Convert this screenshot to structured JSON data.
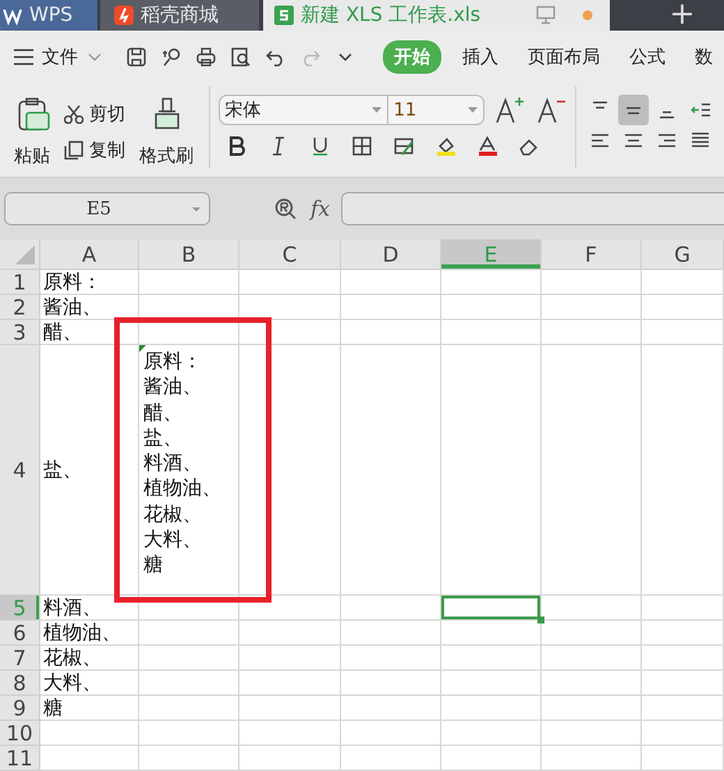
{
  "title_tabs": [
    {
      "kind": "wps",
      "label": "WPS",
      "selected": false
    },
    {
      "kind": "store",
      "label": "稻壳商城",
      "selected": false
    },
    {
      "kind": "sheet",
      "label": "新建 XLS 工作表.xls",
      "selected": true
    }
  ],
  "new_tab": "+",
  "menu": {
    "file_label": "文件",
    "tabs": [
      {
        "label": "开始",
        "selected": true
      },
      {
        "label": "插入",
        "selected": false
      },
      {
        "label": "页面布局",
        "selected": false
      },
      {
        "label": "公式",
        "selected": false
      },
      {
        "label": "数",
        "selected": false
      }
    ]
  },
  "ribbon": {
    "paste": "粘贴",
    "cut": "剪切",
    "copy": "复制",
    "format_painter": "格式刷",
    "font_name": "宋体",
    "font_size": "11",
    "vertical_align": [
      {
        "kind": "top",
        "selected": false
      },
      {
        "kind": "middle",
        "selected": true
      },
      {
        "kind": "bottom",
        "selected": false
      }
    ]
  },
  "formula_bar": {
    "name_box": "E5",
    "fx": "fx"
  },
  "columns": [
    {
      "label": "A",
      "selected": false
    },
    {
      "label": "B",
      "selected": false
    },
    {
      "label": "C",
      "selected": false
    },
    {
      "label": "D",
      "selected": false
    },
    {
      "label": "E",
      "selected": true
    },
    {
      "label": "F",
      "selected": false
    },
    {
      "label": "G",
      "selected": false
    }
  ],
  "rows": [
    {
      "header": "1",
      "kind": "normal",
      "selected": false,
      "a": "原料："
    },
    {
      "header": "2",
      "kind": "normal",
      "selected": false,
      "a": "酱油、"
    },
    {
      "header": "3",
      "kind": "normal",
      "selected": false,
      "a": "醋、"
    },
    {
      "header": "4",
      "kind": "tall",
      "selected": false,
      "a": "盐、",
      "b_lines": [
        "原料：",
        "酱油、",
        "醋、",
        "盐、",
        "料酒、",
        "植物油、",
        "花椒、",
        "大料、",
        "糖"
      ],
      "b_marker": true
    },
    {
      "header": "5",
      "kind": "normal",
      "selected": true,
      "a": "料酒、"
    },
    {
      "header": "6",
      "kind": "normal",
      "selected": false,
      "a": "植物油、"
    },
    {
      "header": "7",
      "kind": "normal",
      "selected": false,
      "a": "花椒、"
    },
    {
      "header": "8",
      "kind": "normal",
      "selected": false,
      "a": "大料、"
    },
    {
      "header": "9",
      "kind": "normal",
      "selected": false,
      "a": "糖"
    },
    {
      "header": "10",
      "kind": "normal",
      "selected": false
    },
    {
      "header": "11",
      "kind": "normal",
      "selected": false
    }
  ]
}
